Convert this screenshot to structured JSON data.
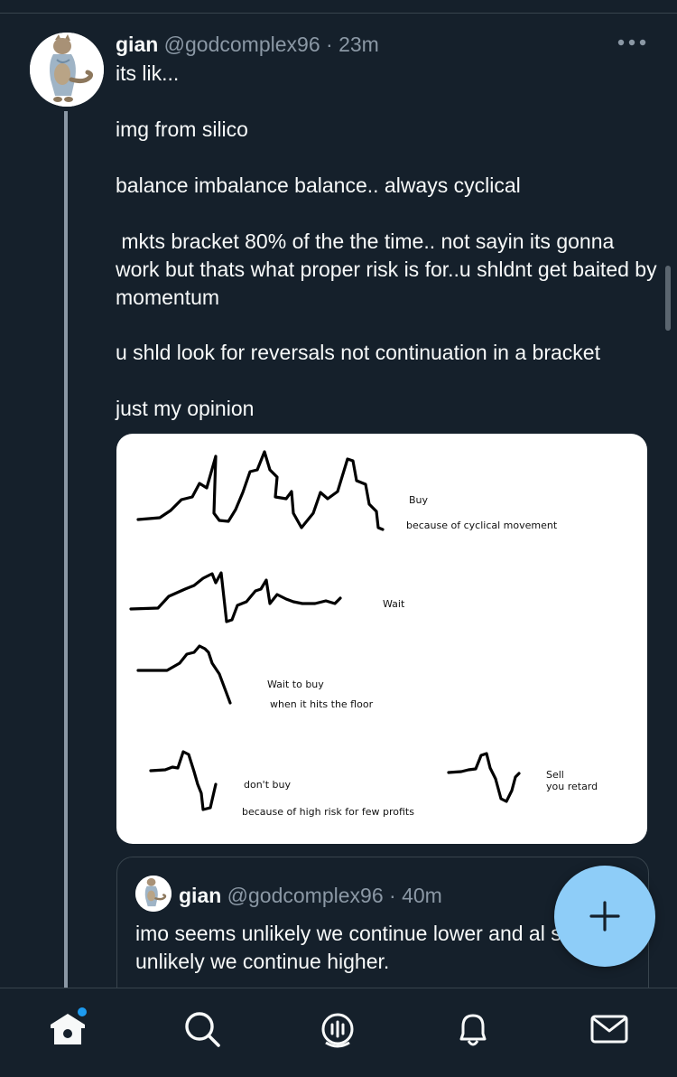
{
  "tweet": {
    "author_name": "gian",
    "author_handle": "@godcomplex96",
    "separator": "·",
    "time_ago": "23m",
    "paragraphs": [
      "its lik...",
      "img from silico",
      "balance imbalance balance.. always cyclical",
      " mkts bracket 80% of the the time.. not sayin its gonna work but thats what proper risk is for..u shldnt get baited by momentum",
      "u shld look for reversals not continuation in a bracket",
      "just my opinion"
    ]
  },
  "media": {
    "labels": {
      "buy": "Buy",
      "buy_reason": "because of cyclical movement",
      "wait": "Wait",
      "wait_to_buy": "Wait to buy",
      "wait_to_buy_reason": "when it hits the floor",
      "dont_buy": "don't buy",
      "dont_buy_reason": "because of high risk for few profits",
      "sell": "Sell",
      "sell_reason": "you retard"
    }
  },
  "quoted_tweet": {
    "author_name": "gian",
    "author_handle": "@godcomplex96",
    "separator": "·",
    "time_ago": "40m",
    "text": "imo seems unlikely we continue lower and al seems unlikely we continue higher."
  },
  "colors": {
    "background": "#15202b",
    "accent": "#1d9bf0",
    "fab": "#8ecdf8",
    "muted_text": "#8b98a5"
  },
  "icons": {
    "more": "more-horizontal-icon",
    "compose": "plus-icon",
    "home": "home-icon",
    "search": "search-icon",
    "spaces": "spaces-icon",
    "notifications": "bell-icon",
    "messages": "envelope-icon"
  }
}
